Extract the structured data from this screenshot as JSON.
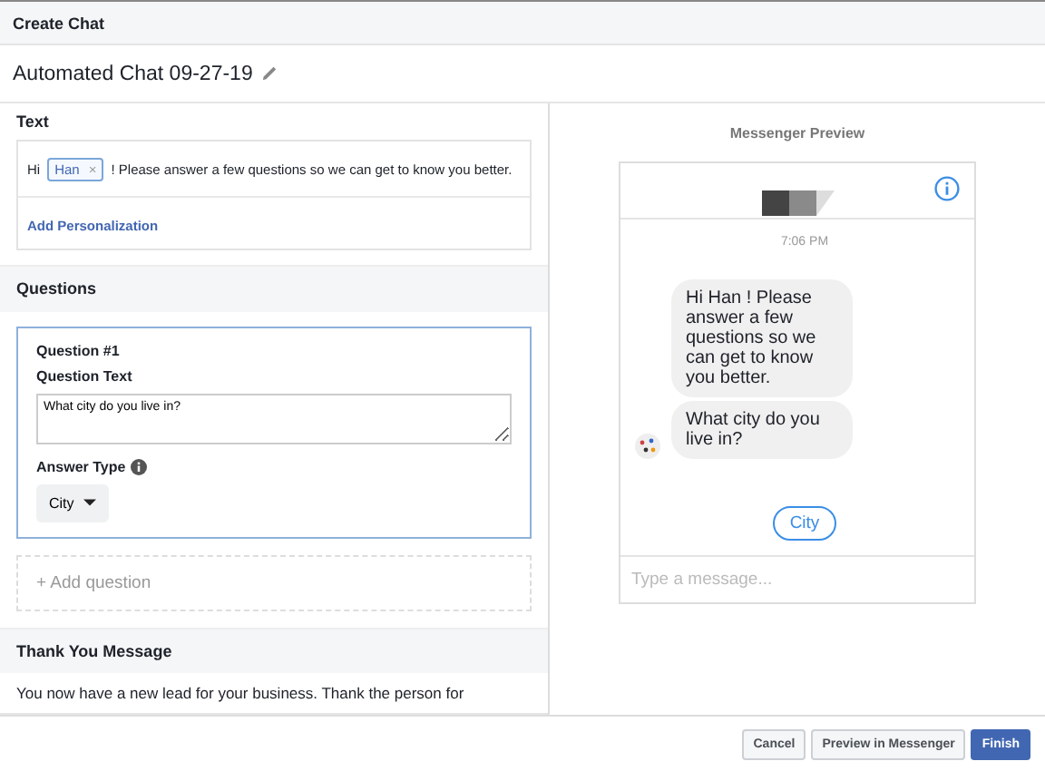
{
  "dialog": {
    "title": "Create Chat"
  },
  "chat_name": "Automated Chat 09-27-19",
  "text_section": {
    "heading": "Text",
    "before": "Hi",
    "token": "Han",
    "token_remove": "×",
    "after": "! Please answer a few questions so we can get to know you better.",
    "link": "Add Personalization"
  },
  "questions_section": {
    "heading": "Questions",
    "questions": [
      {
        "title": "Question #1",
        "text_label": "Question Text",
        "text": "What city do you live in?",
        "answer_label": "Answer Type",
        "answer": "City",
        "selected": true
      }
    ],
    "add": "+ Add question"
  },
  "thank_you": {
    "heading": "Thank You Message",
    "text": "You now have a new lead for your business. Thank the person for"
  },
  "preview": {
    "heading": "Messenger Preview",
    "time": "7:06 PM",
    "messages": [
      "Hi Han  ! Please answer a few questions so we can get to know you better.",
      "What city do you live in?"
    ],
    "quick_reply": "City",
    "placeholder": "Type a message..."
  },
  "buttons": [
    {
      "label": "Cancel",
      "kind": "secondary"
    },
    {
      "label": "Preview in Messenger",
      "kind": "secondary"
    },
    {
      "label": "Finish",
      "kind": "primary"
    }
  ]
}
